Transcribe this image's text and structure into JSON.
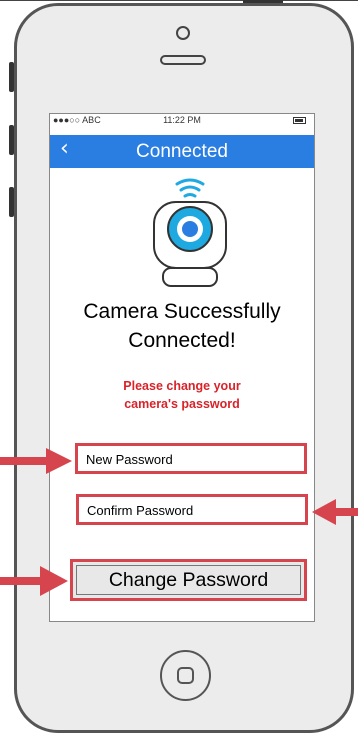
{
  "status_bar": {
    "carrier": "●●●○○ ABC",
    "time": "11:22 PM",
    "battery_icon": "battery-icon"
  },
  "nav": {
    "back_icon": "‹",
    "title": "Connected"
  },
  "main": {
    "illustration_icon": "wifi-camera-icon",
    "success_line1": "Camera Successfully",
    "success_line2": "Connected!",
    "instruction_line1": "Please change your",
    "instruction_line2": "camera's password",
    "new_password_placeholder": "New Password",
    "confirm_password_placeholder": "Confirm Password",
    "change_password_label": "Change Password"
  },
  "colors": {
    "accent": "#2a7de1",
    "highlight": "#d6454e",
    "instruction_text": "#d8232a"
  }
}
